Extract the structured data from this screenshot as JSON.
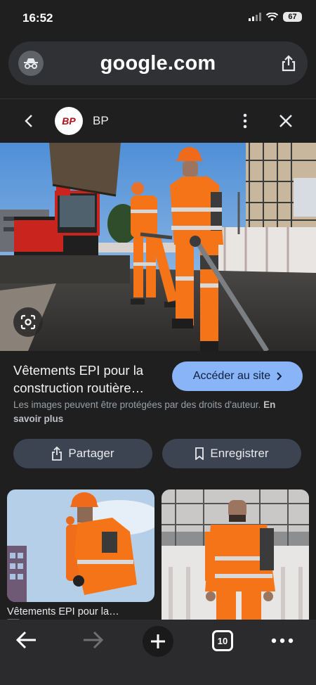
{
  "status": {
    "time": "16:52",
    "battery": "67"
  },
  "url": {
    "domain": "google.com"
  },
  "site": {
    "logo_text": "BP",
    "name": "BP"
  },
  "image_info": {
    "title": "Vêtements EPI pour la construction routière…",
    "visit_button": "Accéder au site",
    "copyright_notice": "Les images peuvent être protégées par des droits d'auteur.",
    "learn_more": "En savoir plus"
  },
  "actions": {
    "share": "Partager",
    "save": "Enregistrer"
  },
  "related": {
    "first_caption": "Vêtements EPI pour la…"
  },
  "toolbar": {
    "tab_count": "10"
  },
  "colors": {
    "accent": "#8ab4f8",
    "background": "#1f1f1f",
    "chip": "#3c4452",
    "safety_orange": "#f57418"
  }
}
